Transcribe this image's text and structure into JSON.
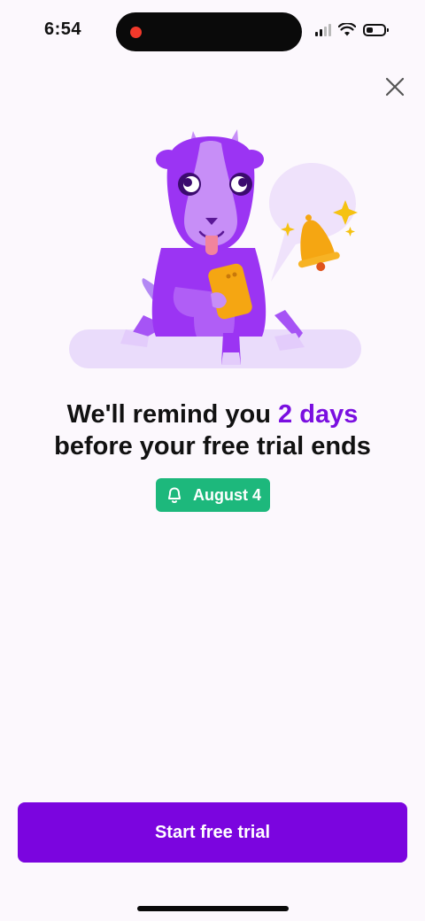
{
  "status_bar": {
    "time": "6:54",
    "battery_level": 0.4,
    "signal_bars_active": 2
  },
  "close_icon": "close-icon",
  "headline": {
    "line1_prefix": "We'll remind you ",
    "line1_highlight": "2 days",
    "line2": "before your free trial ends"
  },
  "reminder_badge": {
    "icon": "bell-icon",
    "date": "August 4"
  },
  "cta": {
    "label": "Start free trial"
  },
  "colors": {
    "background": "#fcf8fd",
    "brand_purple": "#7b05df",
    "highlight_purple": "#7a0fe0",
    "badge_green": "#1db87c",
    "bell_orange": "#f5a612"
  }
}
